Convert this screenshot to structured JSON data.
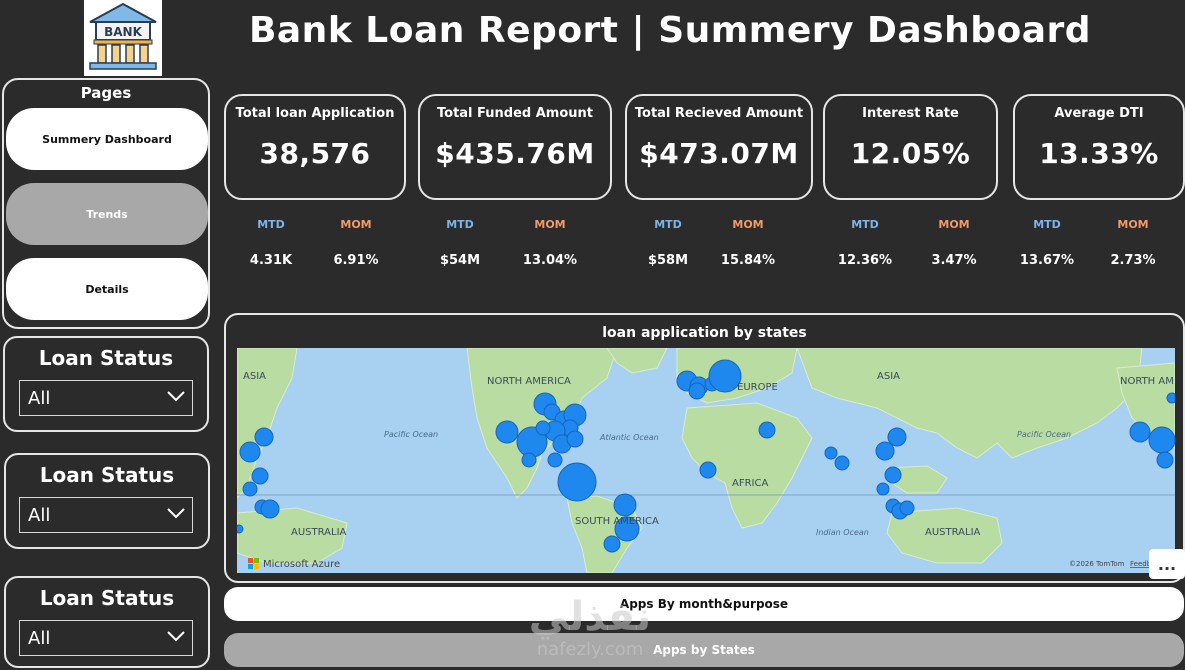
{
  "header": {
    "logo_text": "BANK",
    "title": "Bank Loan Report | Summery Dashboard"
  },
  "sidebar": {
    "pages_title": "Pages",
    "pages": [
      {
        "label": "Summery Dashboard",
        "style": "light"
      },
      {
        "label": "Trends",
        "style": "dark"
      },
      {
        "label": "Details",
        "style": "light"
      }
    ],
    "slicers": [
      {
        "title": "Loan Status",
        "value": "All"
      },
      {
        "title": "Loan Status",
        "value": "All"
      },
      {
        "title": "Loan Status",
        "value": "All"
      }
    ]
  },
  "kpis": [
    {
      "label": "Total loan Application",
      "value": "38,576",
      "mtd_label": "MTD",
      "mtd": "4.31K",
      "mom_label": "MOM",
      "mom": "6.91%"
    },
    {
      "label": "Total Funded Amount",
      "value": "$435.76M",
      "mtd_label": "MTD",
      "mtd": "$54M",
      "mom_label": "MOM",
      "mom": "13.04%"
    },
    {
      "label": "Total Recieved Amount",
      "value": "$473.07M",
      "mtd_label": "MTD",
      "mtd": "$58M",
      "mom_label": "MOM",
      "mom": "15.84%"
    },
    {
      "label": "Interest Rate",
      "value": "12.05%",
      "mtd_label": "MTD",
      "mtd": "12.36%",
      "mom_label": "MOM",
      "mom": "3.47%"
    },
    {
      "label": "Average DTI",
      "value": "13.33%",
      "mtd_label": "MTD",
      "mtd": "13.67%",
      "mom_label": "MOM",
      "mom": "2.73%"
    }
  ],
  "map": {
    "title": "loan application by states",
    "labels": {
      "asia_w": "ASIA",
      "north_america": "NORTH AMERICA",
      "europe": "EUROPE",
      "asia_e": "ASIA",
      "north_america_e": "NORTH AM",
      "pacific_w": "Pacific Ocean",
      "atlantic": "Atlantic Ocean",
      "pacific_e": "Pacific Ocean",
      "africa": "AFRICA",
      "south_america": "SOUTH AMERICA",
      "australia_w": "AUSTRALIA",
      "indian": "Indian Ocean",
      "australia_e": "AUSTRALIA",
      "provider": "Microsoft Azure",
      "copyright": "©2026 TomTom",
      "feedback": "Feedb"
    },
    "more_label": "..."
  },
  "bottom_nav": {
    "btn1": "Apps By month&purpose",
    "btn2": "Apps by States"
  },
  "watermark": {
    "arabic": "نفذلي",
    "site": "nafezly.com"
  },
  "colors": {
    "background": "#2b2b2b",
    "mtd": "#7fb2e8",
    "mom": "#f29a6c",
    "bubble": "#1e88ef",
    "ocean": "#a8d0f0",
    "land": "#b8dca0"
  }
}
